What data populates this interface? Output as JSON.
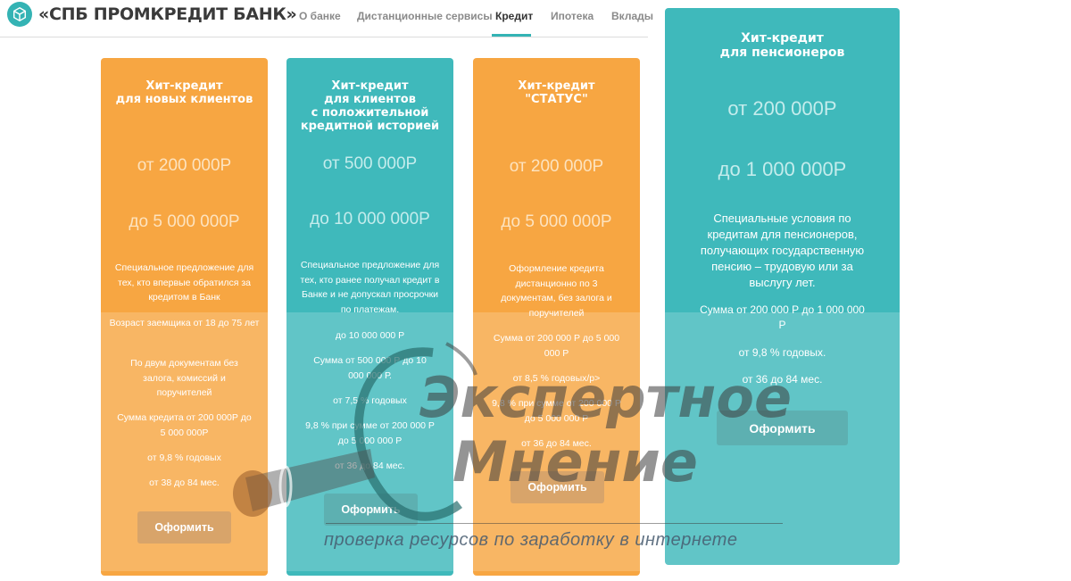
{
  "header": {
    "brand": "«СПБ ПРОМКРЕДИТ БАНК»",
    "nav": [
      {
        "label": "О банке"
      },
      {
        "label": "Дистанционные сервисы"
      },
      {
        "label": "Кредит"
      },
      {
        "label": "Ипотека"
      },
      {
        "label": "Вклады"
      }
    ],
    "active_tab": "Кредит"
  },
  "cards": [
    {
      "title": [
        "Хит-кредит",
        "для новых клиентов"
      ],
      "amount_from": "от 200 000Р",
      "amount_to": "до 5 000 000Р",
      "description": "Специальное предложение для тех, кто впервые обратился за кредитом в Банк",
      "conditions": [
        "Возраст заемщика от 18 до 75 лет",
        "По двум документам без залога, комиссий и поручителей",
        "Сумма кредита от 200 000Р до 5 000 000Р",
        "от 9,8 % годовых",
        "от 38 до 84 мес."
      ],
      "button": "Оформить"
    },
    {
      "title": [
        "Хит-кредит",
        "для клиентов",
        "с положительной",
        "кредитной историей"
      ],
      "amount_from": "от 500 000Р",
      "amount_to": "до 10 000 000Р",
      "description": "Специальное предложение для тех, кто ранее получал кредит в Банке и не допускал просрочки по платежам.",
      "conditions": [
        "до 10 000 000 Р",
        "Сумма от 500 000 Р до 10 000 000 Р.",
        "от 7,5 % годовых",
        "9,8 % при сумме от 200 000 Р до 5 000 000 Р",
        "от 36 до 84 мес."
      ],
      "button": "Оформить"
    },
    {
      "title": [
        "Хит-кредит",
        "\"СТАТУС\""
      ],
      "amount_from": "от 200 000Р",
      "amount_to": "до 5 000 000Р",
      "description": "Оформление кредита дистанционно по 3 документам, без залога и поручителей",
      "conditions": [
        "Сумма от 200 000 Р до 5 000 000 Р",
        "от 8,5 % годовых/p>",
        "9,8 % при сумме от 200 000 Р до 5 000 000 Р",
        "от 36 до 84 мес."
      ],
      "button": "Оформить"
    },
    {
      "title": [
        "Хит-кредит",
        "для пенсионеров"
      ],
      "amount_from": "от 200 000Р",
      "amount_to": "до 1 000 000Р",
      "description": "Специальные условия по кредитам для пенсионеров, получающих государственную пенсию – трудовую или за выслугу лет.",
      "conditions": [
        "Сумма от 200 000 Р до 1 000 000 Р",
        "от 9,8 % годовых.",
        "от 36 до 84 мес."
      ],
      "button": "Оформить"
    }
  ],
  "watermark": {
    "line1": "Экспертное",
    "line2": "Мнение",
    "subtitle": "проверка ресурсов по заработку в интернете"
  },
  "colors": {
    "orange": "#f7a642",
    "teal": "#3fb9bb",
    "accent": "#34b3b4"
  }
}
